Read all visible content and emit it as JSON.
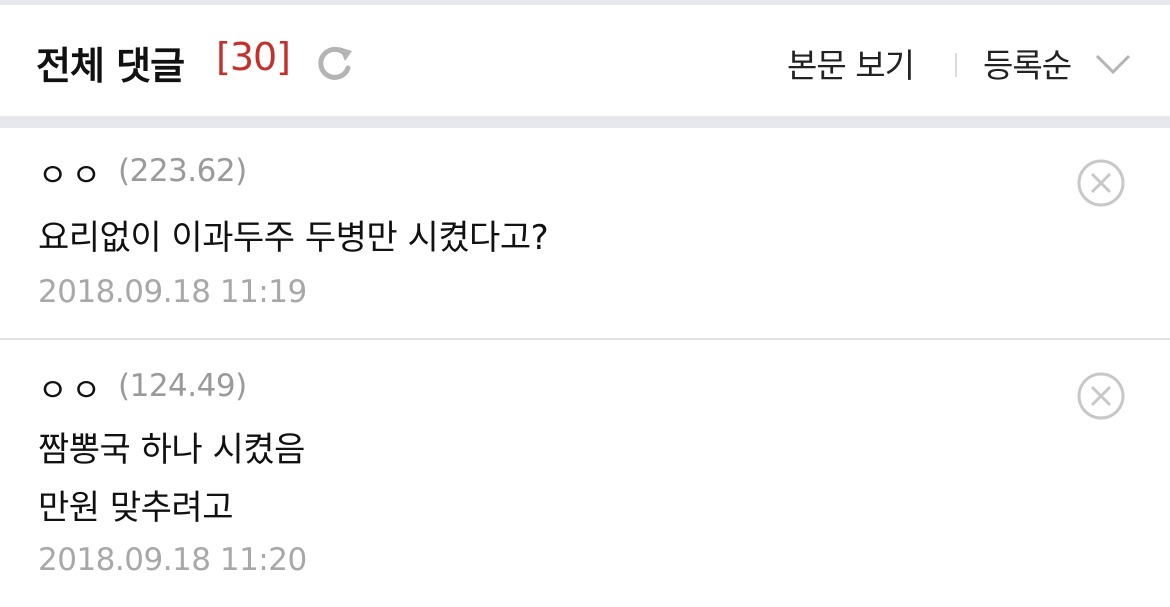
{
  "header": {
    "title": "전체 댓글",
    "count": "[30]",
    "view_body_label": "본문 보기",
    "sort_label": "등록순"
  },
  "comments": [
    {
      "author": "ㅇㅇ",
      "ip": "(223.62)",
      "text": "요리없이 이과두주 두병만 시켰다고?",
      "date": "2018.09.18 11:19"
    },
    {
      "author": "ㅇㅇ",
      "ip": "(124.49)",
      "text_line1": "짬뽕국 하나 시켰음",
      "text_line2": "만원 맞추려고",
      "date": "2018.09.18 11:20"
    }
  ],
  "colors": {
    "accent_count": "#c4302b",
    "band": "#e6e8ee",
    "muted_text": "#a8a8a8"
  }
}
